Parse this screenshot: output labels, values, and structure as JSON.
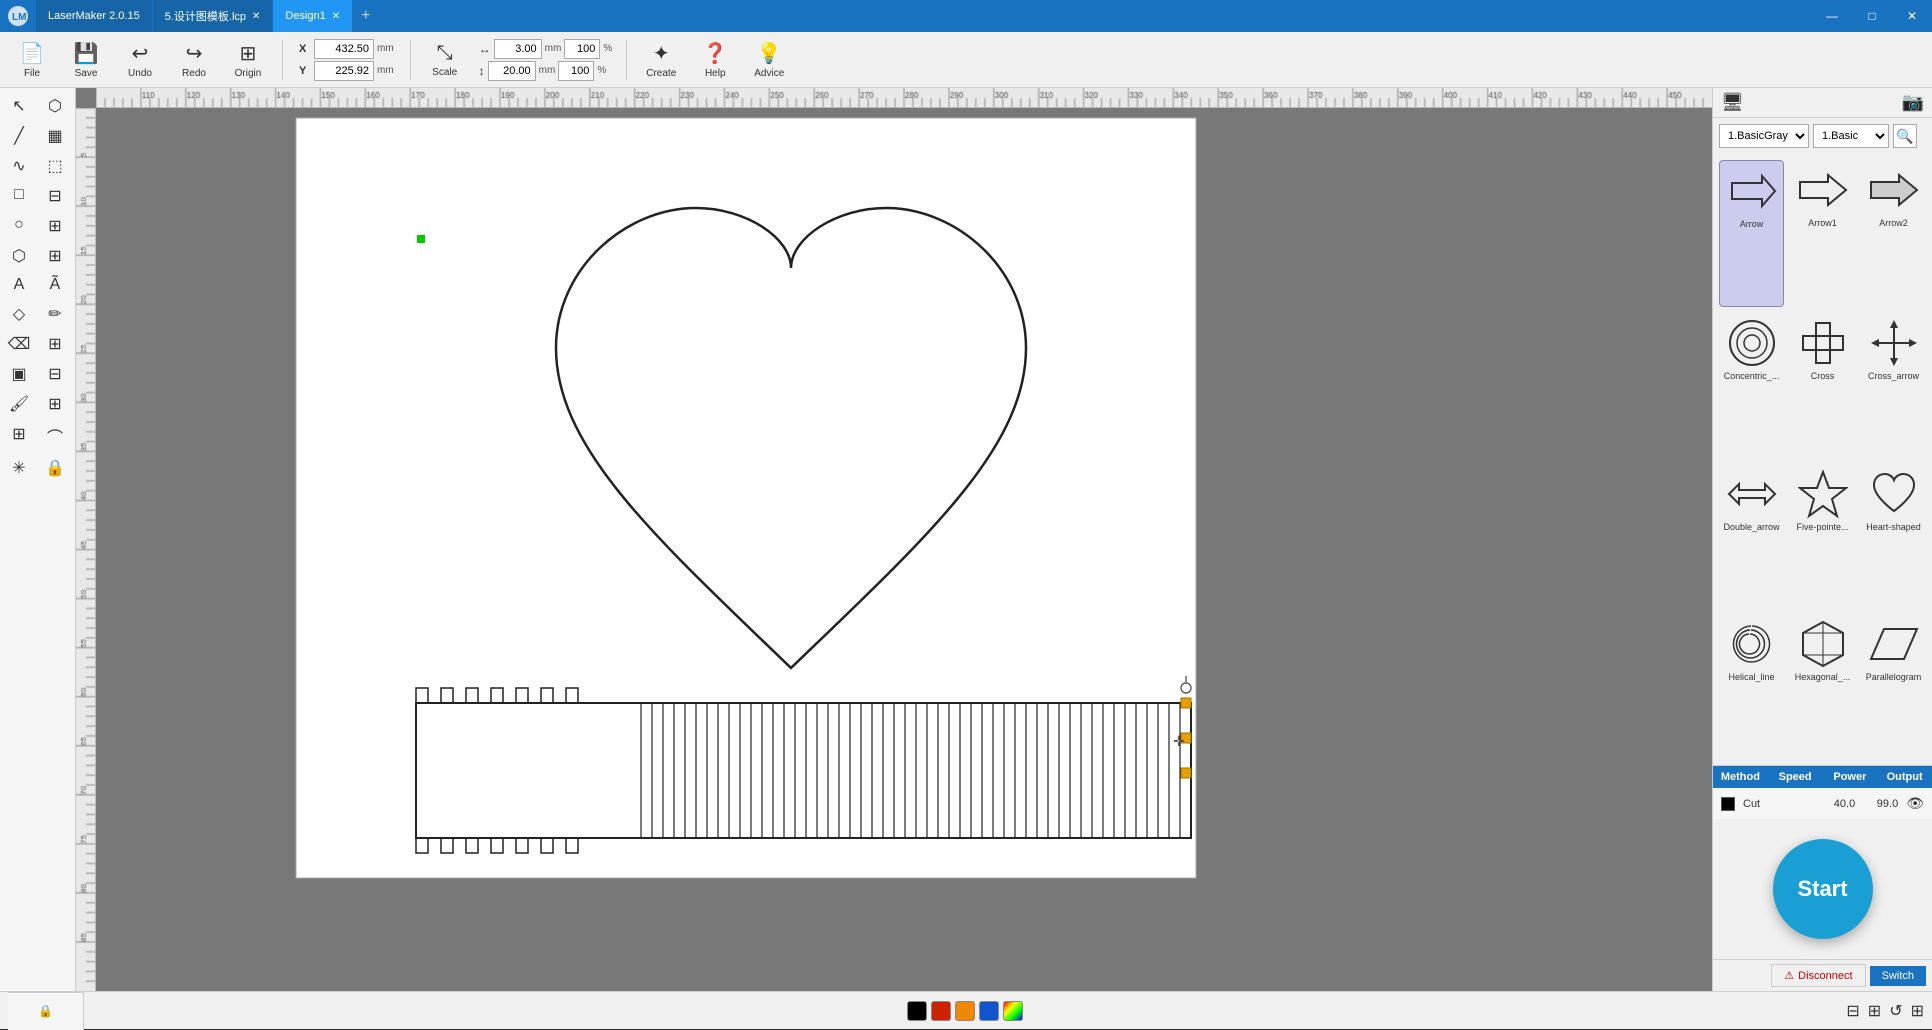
{
  "titlebar": {
    "app_name": "LaserMaker 2.0.15",
    "tabs": [
      {
        "label": "LaserMaker 2.0.15",
        "active": false,
        "closable": false
      },
      {
        "label": "5.设计图模板.lcp",
        "active": false,
        "closable": true
      },
      {
        "label": "Design1",
        "active": true,
        "closable": true
      }
    ],
    "add_tab": "+",
    "minimize": "—",
    "maximize": "□",
    "close": "✕"
  },
  "toolbar": {
    "file_label": "File",
    "save_label": "Save",
    "undo_label": "Undo",
    "redo_label": "Redo",
    "origin_label": "Origin",
    "scale_label": "Scale",
    "create_label": "Create",
    "help_label": "Help",
    "advice_label": "Advice",
    "x_label": "X",
    "y_label": "Y",
    "x_value": "432.50",
    "y_value": "225.92",
    "unit": "mm",
    "width_value": "3.00",
    "height_value": "20.00",
    "width_pct": "100",
    "height_pct": "100"
  },
  "shapes": {
    "dropdown1_value": "1.BasicGray",
    "dropdown2_value": "1.Basic",
    "items": [
      {
        "name": "Arrow",
        "selected": true
      },
      {
        "name": "Arrow1",
        "selected": false
      },
      {
        "name": "Arrow2",
        "selected": false
      },
      {
        "name": "Concentric_...",
        "selected": false
      },
      {
        "name": "Cross",
        "selected": false
      },
      {
        "name": "Cross_arrow",
        "selected": false
      },
      {
        "name": "Double_arrow",
        "selected": false
      },
      {
        "name": "Five-pointe...",
        "selected": false
      },
      {
        "name": "Heart-shaped",
        "selected": false
      },
      {
        "name": "Helical_line",
        "selected": false
      },
      {
        "name": "Hexagonal_...",
        "selected": false
      },
      {
        "name": "Parallelogram",
        "selected": false
      }
    ]
  },
  "layers": {
    "tabs": [
      "Method",
      "Speed",
      "Power",
      "Output"
    ],
    "rows": [
      {
        "color": "#000000",
        "type": "Cut",
        "speed": "40.0",
        "power": "99.0",
        "visible": true
      }
    ]
  },
  "start_button": "Start",
  "bottom": {
    "swatches": [
      "#000000",
      "#cc2200",
      "#ee8800",
      "#1155cc",
      "#aa44bb"
    ],
    "disconnect_label": "Disconnect",
    "switch_label": "Switch"
  }
}
